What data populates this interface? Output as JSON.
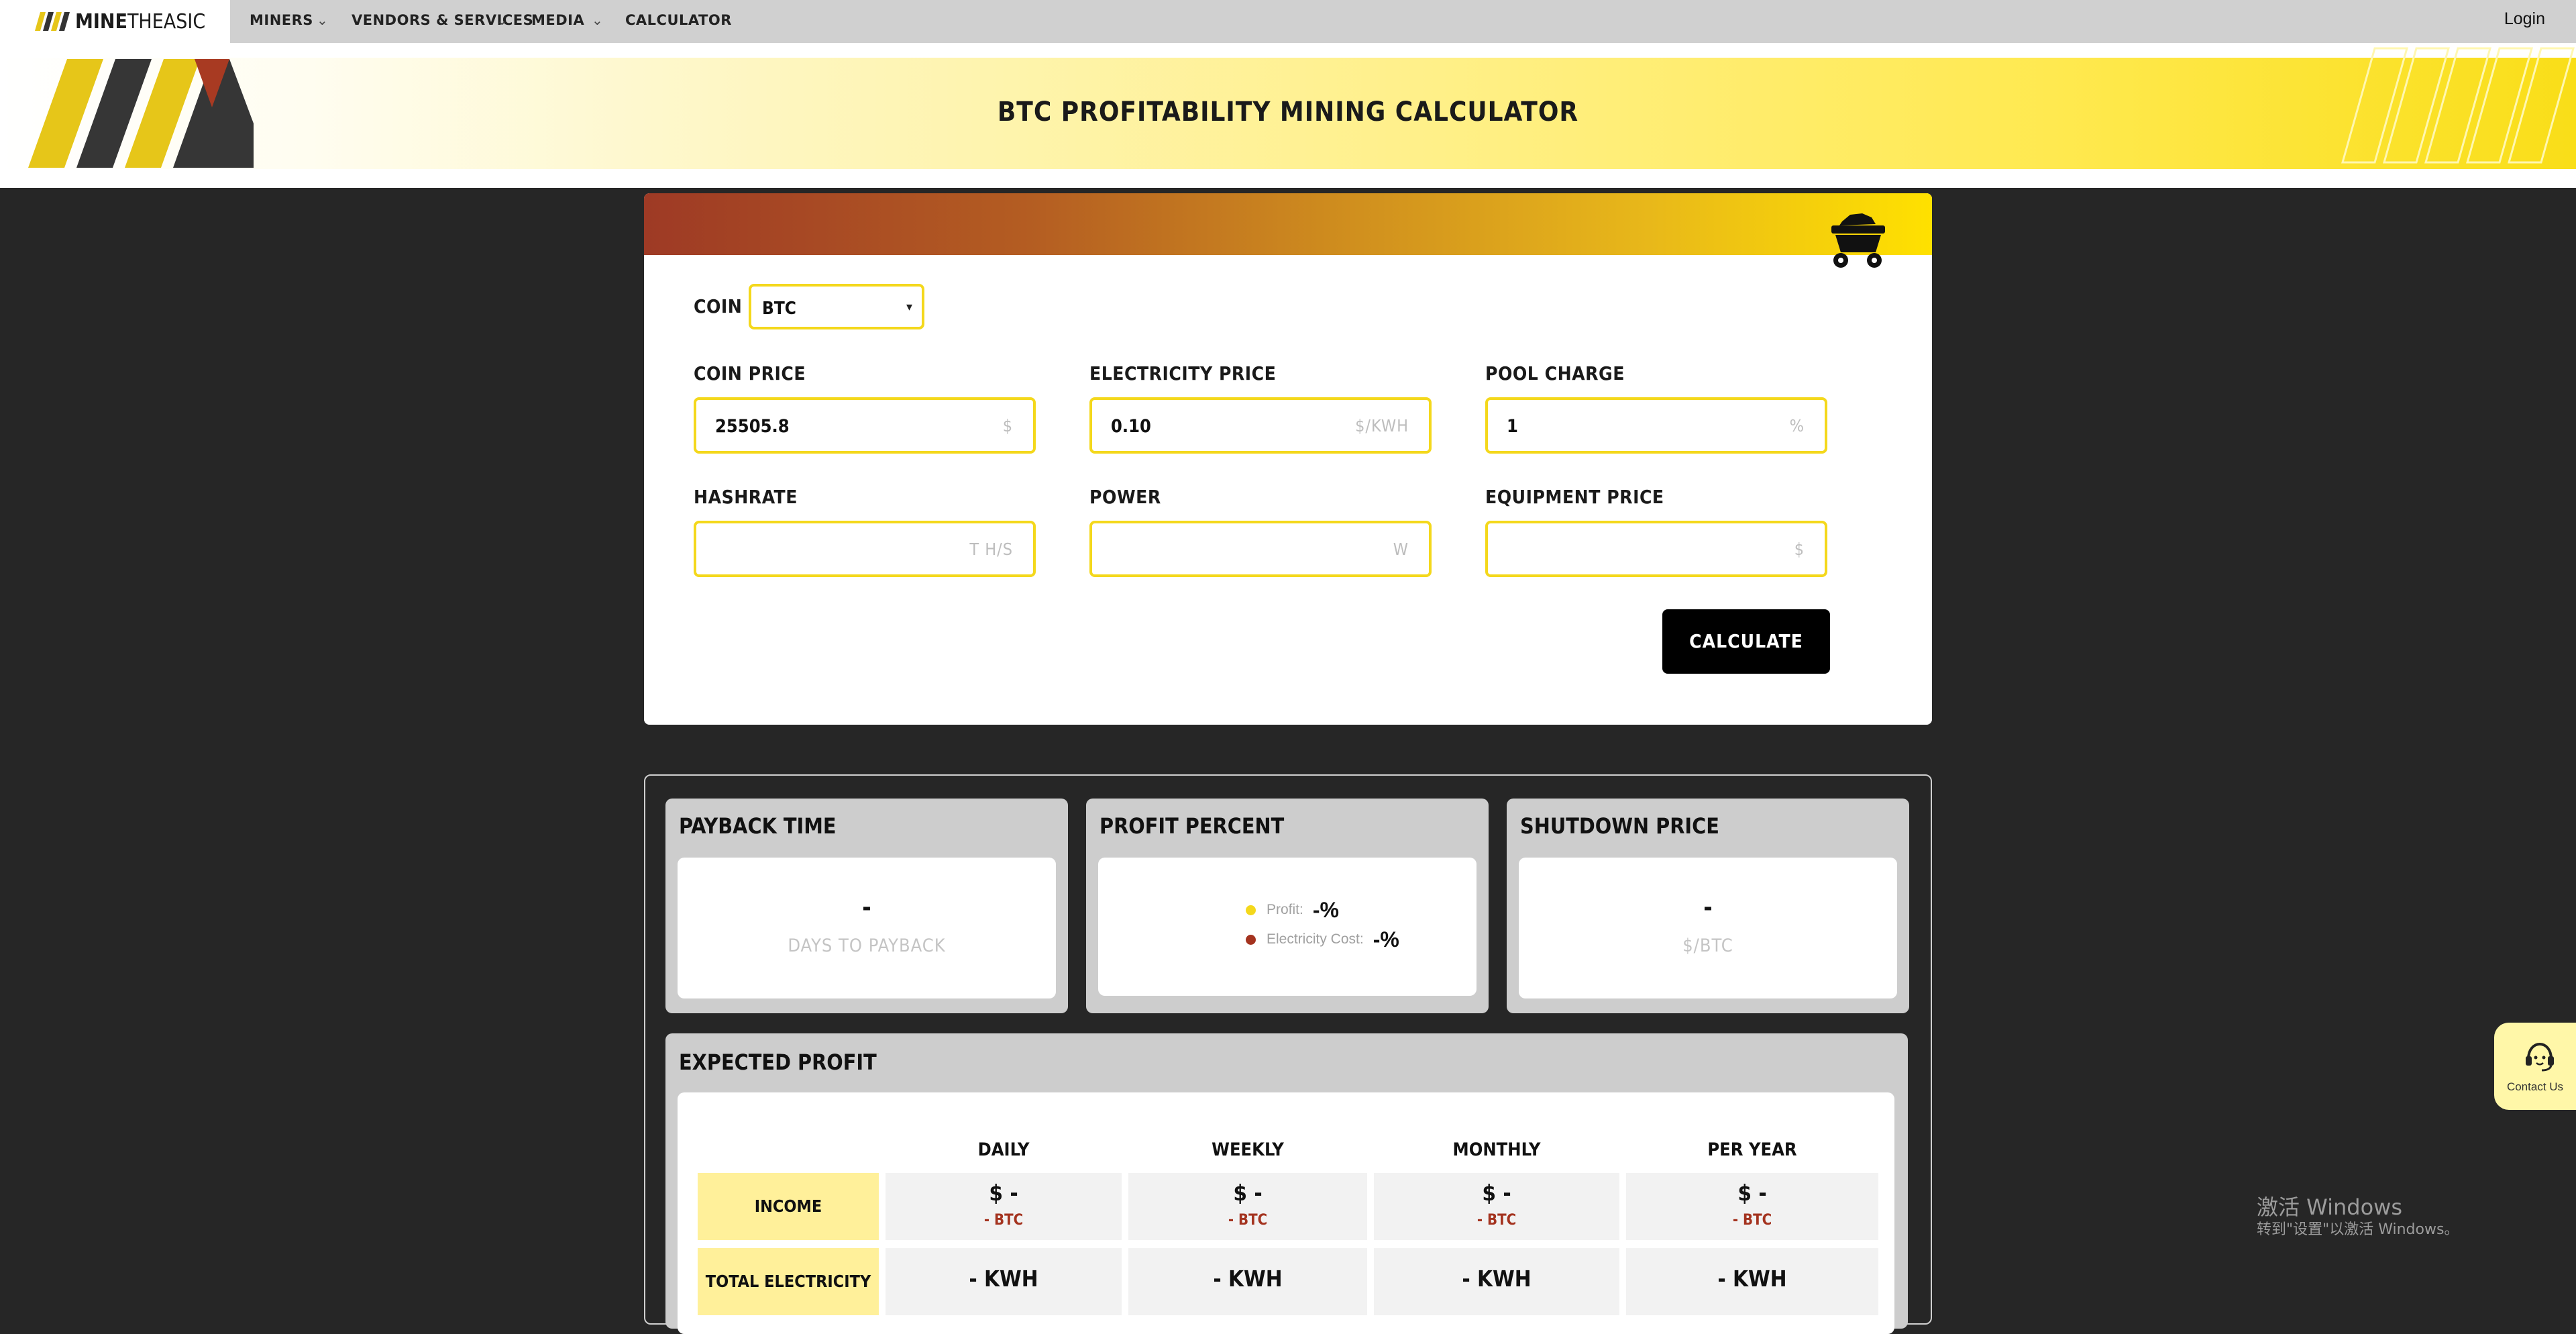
{
  "nav": {
    "brand_bold": "MINE",
    "brand_light": "THEASIC",
    "items": [
      {
        "label": "MINERS",
        "has_menu": true
      },
      {
        "label": "VENDORS & SERVICES",
        "has_menu": true
      },
      {
        "label": "MEDIA",
        "has_menu": true
      },
      {
        "label": "CALCULATOR",
        "has_menu": false
      }
    ],
    "chevron": "⌄",
    "login": "Login"
  },
  "banner": {
    "title": "BTC PROFITABILITY MINING CALCULATOR"
  },
  "form": {
    "coin_label": "COIN",
    "coin_value": "BTC",
    "coin_caret": "▾",
    "fields": {
      "coin_price": {
        "label": "COIN PRICE",
        "value": "25505.8",
        "unit": "$"
      },
      "electricity_price": {
        "label": "ELECTRICITY PRICE",
        "value": "0.10",
        "unit": "$/KWH"
      },
      "pool_charge": {
        "label": "POOL CHARGE",
        "value": "1",
        "unit": "%"
      },
      "hashrate": {
        "label": "HASHRATE",
        "value": "",
        "unit": "T H/S"
      },
      "power": {
        "label": "POWER",
        "value": "",
        "unit": "W"
      },
      "equipment_price": {
        "label": "EQUIPMENT PRICE",
        "value": "",
        "unit": "$"
      }
    },
    "calculate_label": "CALCULATE"
  },
  "results": {
    "payback": {
      "title": "PAYBACK TIME",
      "value": "-",
      "sub": "DAYS TO PAYBACK"
    },
    "profit_percent": {
      "title": "PROFIT PERCENT",
      "profit_label": "Profit:",
      "profit_value": "-%",
      "electricity_label": "Electricity Cost:",
      "electricity_value": "-%"
    },
    "shutdown": {
      "title": "SHUTDOWN PRICE",
      "value": "-",
      "sub": "$/BTC"
    },
    "expected": {
      "title": "EXPECTED PROFIT",
      "columns": [
        "DAILY",
        "WEEKLY",
        "MONTHLY",
        "PER YEAR"
      ],
      "income_label": "INCOME",
      "income": [
        {
          "usd": "$ -",
          "btc": "- BTC"
        },
        {
          "usd": "$ -",
          "btc": "- BTC"
        },
        {
          "usd": "$ -",
          "btc": "- BTC"
        },
        {
          "usd": "$ -",
          "btc": "- BTC"
        }
      ],
      "electricity_label": "TOTAL ELECTRICITY",
      "electricity": [
        "- KWH",
        "- KWH",
        "- KWH",
        "- KWH"
      ]
    }
  },
  "contact": {
    "label": "Contact Us"
  },
  "watermark": {
    "line1": "激活 Windows",
    "line2": "转到\"设置\"以激活 Windows。"
  },
  "colors": {
    "accent": "#f4d81c",
    "dark": "#262626",
    "btc_red": "#a4331f"
  }
}
